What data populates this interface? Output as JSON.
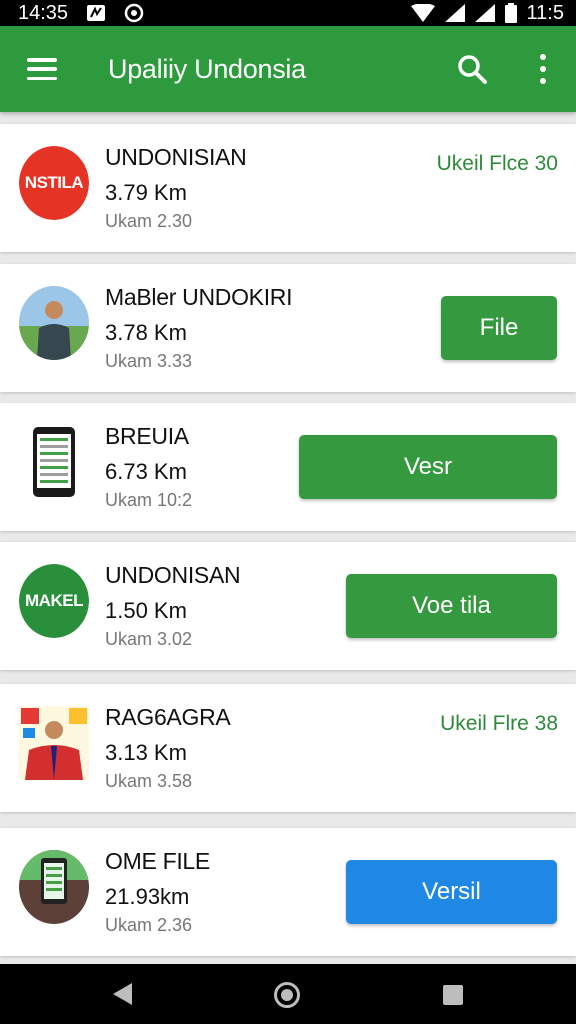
{
  "status_bar": {
    "time": "14:35",
    "battery_time": "11:5"
  },
  "app_bar": {
    "title": "Upaliiy Undonsia"
  },
  "items": [
    {
      "name": "UNDONISIAN",
      "distance": "3.79 Km",
      "time": "Ukam 2.30",
      "logo_text": "NSTILA",
      "logo_color": "#e53326",
      "action_type": "link",
      "action_label": "Ukeil Flce 30"
    },
    {
      "name": "MaBler UNDOKIRI",
      "distance": "3.78 Km",
      "time": "Ukam 3.33",
      "action_type": "button",
      "action_label": "File"
    },
    {
      "name": "BREUIA",
      "distance": "6.73 Km",
      "time": "Ukam 10:2",
      "action_type": "button",
      "action_label": "Vesr"
    },
    {
      "name": "UNDONISAN",
      "distance": "1.50 Km",
      "time": "Ukam 3.02",
      "logo_text": "MAKEL",
      "logo_color": "#2a8f3a",
      "action_type": "button",
      "action_label": "Voe tila"
    },
    {
      "name": "RAG6AGRA",
      "distance": "3.13 Km",
      "time": "Ukam 3.58",
      "action_type": "link",
      "action_label": "Ukeil Flre 38"
    },
    {
      "name": "OME FILE",
      "distance": "21.93km",
      "time": "Ukam 2.36",
      "action_type": "button",
      "action_label": "Versil",
      "button_color": "#1f88e5"
    }
  ]
}
